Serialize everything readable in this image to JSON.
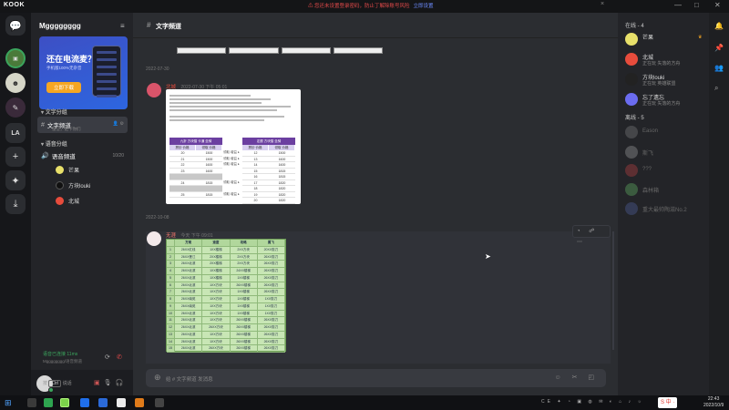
{
  "window": {
    "app_logo": "KOOK",
    "notice": "您还未设置登录密码，防止丁解除账号风险",
    "notice_link": "立即设置",
    "notice_close": "×",
    "controls": [
      "—",
      "□",
      "✕"
    ]
  },
  "server_rail": {
    "items": [
      {
        "label": "",
        "icon": "chat-icon"
      },
      {
        "label": "",
        "icon": "server-avatar-1"
      },
      {
        "label": "",
        "icon": "server-avatar-2"
      },
      {
        "label": "",
        "icon": "server-avatar-3"
      },
      {
        "label": "LA",
        "icon": "text-avatar"
      },
      {
        "label": "+",
        "icon": "add-server-icon"
      },
      {
        "label": "✦",
        "icon": "explore-icon"
      },
      {
        "label": "⤓",
        "icon": "download-icon"
      }
    ]
  },
  "channel_panel": {
    "server_name": "Mgggggggg",
    "menu_icon": "≡",
    "banner": {
      "title": "还在电流麦？",
      "subtitle": "手机版100%无杂音",
      "button": "立即下载"
    },
    "categories": [
      {
        "name": "文字分组",
        "channels": [
          {
            "name": "文字频道",
            "sub": "留言，记下你们",
            "active": true
          }
        ]
      },
      {
        "name": "语音分组",
        "channels": [
          {
            "name": "语音频道",
            "sub": "",
            "active": false,
            "members": [
              "芒果",
              "方块louki",
              "北城"
            ]
          }
        ]
      }
    ],
    "user_limit": "10/20",
    "voice_status": "语音已连接 11ms",
    "voice_sub": "Mgggggggg/语音频道",
    "userbar": {
      "hint_prefix": "按",
      "hint_key": "Ctrl",
      "hint_suffix": "说话"
    }
  },
  "main": {
    "channel_title": "文字频道",
    "dates": [
      "2022-07-30",
      "2022-10-08"
    ],
    "msg1": {
      "author": "北城",
      "author_color": "#e74c3c",
      "time": "2022-07-30 下午 05:01"
    },
    "msg2": {
      "author": "无涯",
      "author_color": "#ff7a6e",
      "time": "今天 下午 09:01"
    },
    "image1": {
      "table_left": {
        "title": "九折 方块猫 卡通 坐骑",
        "cols": [
          "攒钞 价格",
          "领取 价格"
        ],
        "rows": [
          [
            "20",
            "1500"
          ],
          [
            "21",
            "1500"
          ],
          [
            "22",
            "1600"
          ],
          [
            "23",
            "1600"
          ],
          [
            "",
            ""
          ],
          [
            "24",
            "1815"
          ],
          [
            "",
            ""
          ],
          [
            "25",
            "1815"
          ]
        ]
      },
      "table_right": {
        "title": "定额 方块猫 坐骑",
        "cols": [
          "攒钞 价格",
          "领取 价格"
        ],
        "rows": [
          [
            "12",
            "1500"
          ],
          [
            "13",
            "1600"
          ],
          [
            "14",
            "1600"
          ],
          [
            "15",
            "1815"
          ],
          [
            "16",
            "1815"
          ],
          [
            "17",
            "1820"
          ],
          [
            "18",
            "1820"
          ],
          [
            "19",
            "1820"
          ],
          [
            "20",
            "1820"
          ]
        ]
      },
      "notes": [
        "领取 增益 ▸",
        "领取 增益 ▸",
        "领取 增益 ▸",
        "领取 增益 ▸",
        "领取 增益 ▸"
      ]
    },
    "image2": {
      "headers": [
        "",
        "方案",
        "速度",
        "攻略",
        "属飞"
      ],
      "rows": [
        [
          "1",
          "26XX红线",
          "1XX楼梯",
          "2XX方块",
          "20XX剪刀"
        ],
        [
          "2",
          "26XX蓬江",
          "2XX楼梯",
          "2XX方块",
          "26XX剪刀"
        ],
        [
          "3",
          "26XX北滨",
          "2XX楼梯",
          "2XX方块",
          "26XX剪刀"
        ],
        [
          "4",
          "26XX北滨",
          "1XX楼梯",
          "24XX楼梯",
          "26XX剪刀"
        ],
        [
          "5",
          "26XX北滨",
          "1XX楼梯",
          "1XX楼梯",
          "26XX剪刀"
        ],
        [
          "6",
          "26XX北滨",
          "1XX方块",
          "26XX楼梯",
          "26XX剪刀"
        ],
        [
          "7",
          "26XX北滨",
          "1XX方块",
          "1XX楼梯",
          "26XX剪刀"
        ],
        [
          "8",
          "26XX南苑",
          "1XX方块",
          "1XX楼梯",
          "1XX剪刀"
        ],
        [
          "9",
          "26XX南苑",
          "1XX方块",
          "1XX楼梯",
          "1XX剪刀"
        ],
        [
          "10",
          "26XX北滨",
          "1XX方块",
          "1XX楼梯",
          "1XX剪刀"
        ],
        [
          "11",
          "26XX北滨",
          "1XX方块",
          "26XX楼梯",
          "26XX剪刀"
        ],
        [
          "12",
          "26XX北滨",
          "26XX方块",
          "26XX楼梯",
          "26XX剪刀"
        ],
        [
          "13",
          "26XX北滨",
          "1XX方块",
          "26XX楼梯",
          "26XX剪刀"
        ],
        [
          "14",
          "26XX北滨",
          "1XX方块",
          "26XX楼梯",
          "26XX剪刀"
        ],
        [
          "15",
          "26XX北滨",
          "26XX方块",
          "26XX楼梯",
          "26XX剪刀"
        ]
      ]
    },
    "hover_tools": "◔ ☍ ⋯",
    "input_placeholder": "给 # 文字频道 发消息",
    "input_tools": "☺ ✂ ◰"
  },
  "members_panel": {
    "online_header": "在线 - 4",
    "offline_header": "离线 - 5",
    "online": [
      {
        "name": "芒果",
        "status": "",
        "avatar_color": "#e8e06a",
        "crown": true
      },
      {
        "name": "北城",
        "status": "正在玩 失落的方舟",
        "avatar_color": "#e74c3c",
        "crown": false
      },
      {
        "name": "方块louki",
        "status": "正在玩 英雄联盟",
        "avatar_color": "#222222",
        "crown": false
      },
      {
        "name": "忘了遗忘",
        "status": "正在玩 失落的方舟",
        "avatar_color": "#6b6cf0",
        "crown": false
      }
    ],
    "offline": [
      {
        "name": "Eason",
        "avatar_color": "#888888"
      },
      {
        "name": "斯飞",
        "avatar_color": "#aaaaaa"
      },
      {
        "name": "???",
        "avatar_color": "#cc4444"
      },
      {
        "name": "森林箱",
        "avatar_color": "#6ac46a"
      },
      {
        "name": "重大最帅陶滋No.2",
        "avatar_color": "#5566aa"
      }
    ]
  },
  "taskbar": {
    "ime": "S 中 ·",
    "time": "22:43",
    "date": "2022/10/9"
  },
  "colors": {
    "accent": "#5865f2",
    "online": "#3ba55d",
    "notice": "#e24a4a"
  }
}
